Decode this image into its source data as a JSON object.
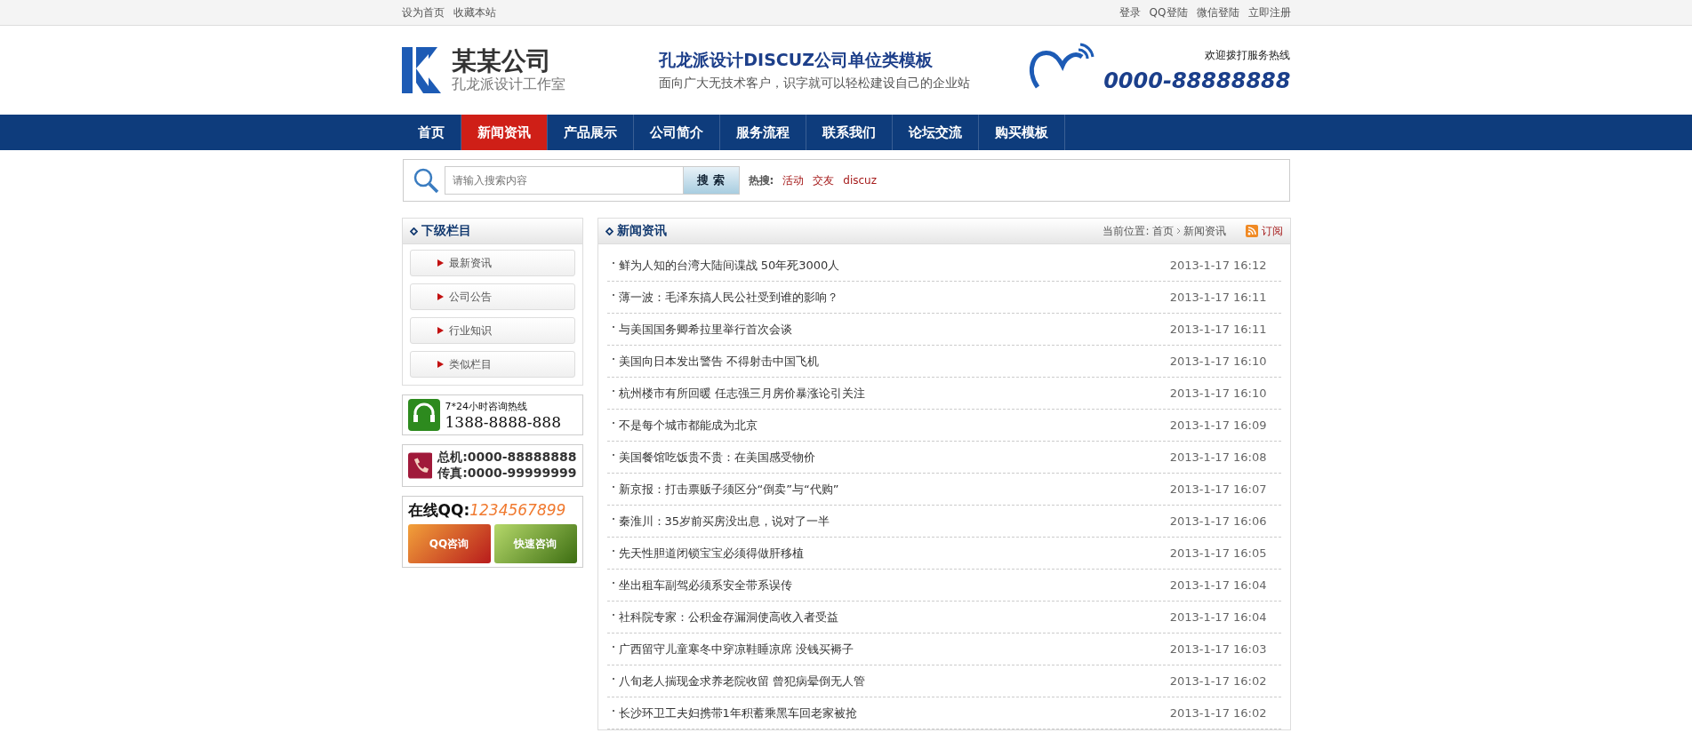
{
  "top_bar": {
    "left_links": [
      "设为首页",
      "收藏本站"
    ],
    "right_links": [
      "登录",
      "QQ登陆",
      "微信登陆",
      "立即注册"
    ]
  },
  "header": {
    "logo_name": "某某公司",
    "logo_sub": "孔龙派设计工作室",
    "slogan_title": "孔龙派设计DISCUZ公司单位类模板",
    "slogan_sub": "面向广大无技术客户，识字就可以轻松建设自己的企业站",
    "hotline_label": "欢迎拨打服务热线",
    "hotline_number": "0000-88888888"
  },
  "nav": [
    {
      "label": "首页",
      "selected": false
    },
    {
      "label": "新闻资讯",
      "selected": true
    },
    {
      "label": "产品展示",
      "selected": false
    },
    {
      "label": "公司简介",
      "selected": false
    },
    {
      "label": "服务流程",
      "selected": false
    },
    {
      "label": "联系我们",
      "selected": false
    },
    {
      "label": "论坛交流",
      "selected": false
    },
    {
      "label": "购买模板",
      "selected": false
    }
  ],
  "search": {
    "placeholder": "请输入搜索内容",
    "button": "搜 索",
    "hot_label": "热搜:",
    "hot_words": [
      "活动",
      "交友",
      "discuz"
    ]
  },
  "sidebar": {
    "title": "下级栏目",
    "items": [
      "最新资讯",
      "公司公告",
      "行业知识",
      "类似栏目"
    ],
    "hotline": {
      "label": "7*24小时咨询热线",
      "number": "1388-8888-888"
    },
    "phones": [
      {
        "label": "总机:",
        "number": "0000-88888888"
      },
      {
        "label": "传真:",
        "number": "0000-99999999"
      }
    ],
    "qq": {
      "label": "在线QQ:",
      "number": "1234567899",
      "buttons": [
        "QQ咨询",
        "快速咨询"
      ]
    }
  },
  "main": {
    "title": "新闻资讯",
    "breadcrumb_label": "当前位置:",
    "breadcrumb": [
      "首页",
      "新闻资讯"
    ],
    "subscribe": "订阅",
    "news": [
      {
        "title": "鲜为人知的台湾大陆间谍战 50年死3000人",
        "time": "2013-1-17 16:12"
      },
      {
        "title": "薄一波：毛泽东搞人民公社受到谁的影响？",
        "time": "2013-1-17 16:11"
      },
      {
        "title": "与美国国务卿希拉里举行首次会谈",
        "time": "2013-1-17 16:11"
      },
      {
        "title": "美国向日本发出警告 不得射击中国飞机",
        "time": "2013-1-17 16:10"
      },
      {
        "title": "杭州楼市有所回暖 任志强三月房价暴涨论引关注",
        "time": "2013-1-17 16:10"
      },
      {
        "title": "不是每个城市都能成为北京",
        "time": "2013-1-17 16:09"
      },
      {
        "title": "美国餐馆吃饭贵不贵：在美国感受物价",
        "time": "2013-1-17 16:08"
      },
      {
        "title": "新京报：打击票贩子须区分“倒卖”与“代购”",
        "time": "2013-1-17 16:07"
      },
      {
        "title": "秦淮川：35岁前买房没出息，说对了一半",
        "time": "2013-1-17 16:06"
      },
      {
        "title": "先天性胆道闭锁宝宝必须得做肝移植",
        "time": "2013-1-17 16:05"
      },
      {
        "title": "坐出租车副驾必须系安全带系误传",
        "time": "2013-1-17 16:04"
      },
      {
        "title": "社科院专家：公积金存漏洞使高收入者受益",
        "time": "2013-1-17 16:04"
      },
      {
        "title": "广西留守儿童寒冬中穿凉鞋睡凉席 没钱买褥子",
        "time": "2013-1-17 16:03"
      },
      {
        "title": "八旬老人揣现金求养老院收留 曾犯病晕倒无人管",
        "time": "2013-1-17 16:02"
      },
      {
        "title": "长沙环卫工夫妇携带1年积蓄乘黑车回老家被抢",
        "time": "2013-1-17 16:02"
      }
    ]
  }
}
